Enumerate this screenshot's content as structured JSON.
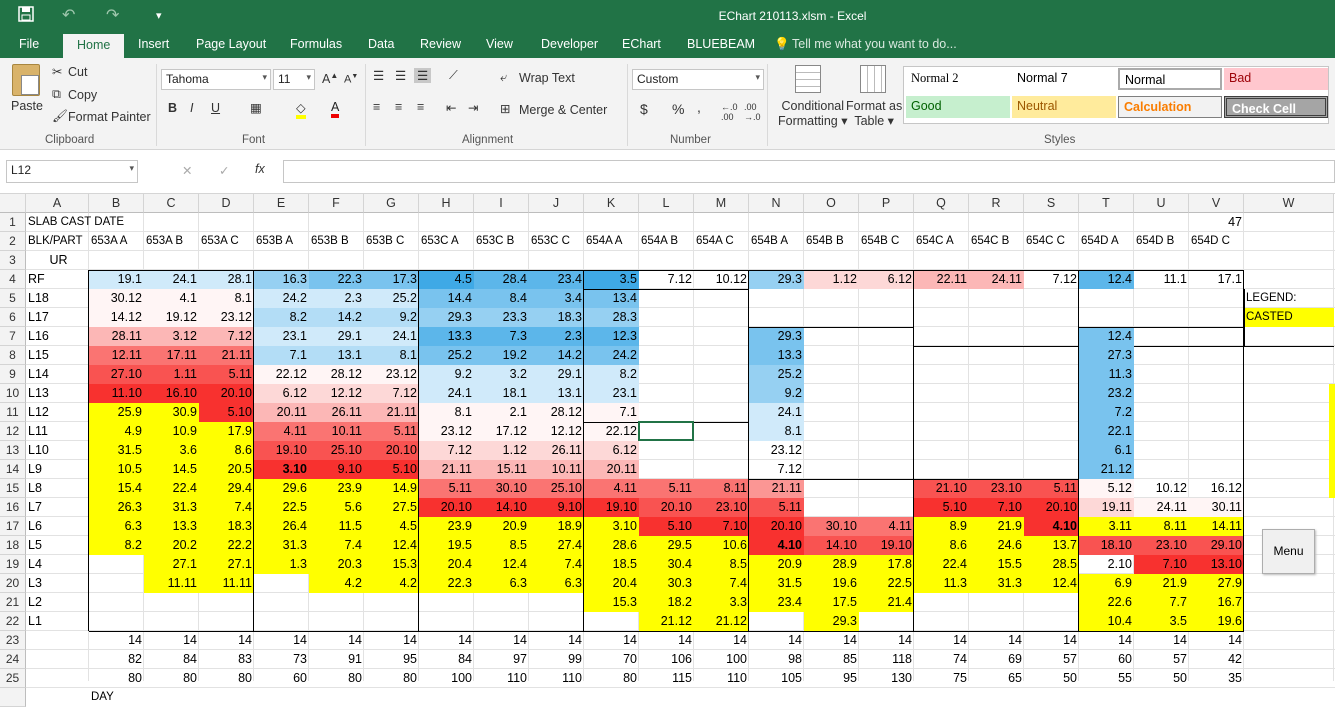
{
  "window": {
    "title": "EChart 210113.xlsm - Excel"
  },
  "quick_access": {
    "save_icon": "save-icon",
    "undo_icon": "undo-icon",
    "redo_icon": "redo-icon",
    "customize_icon": "customize-icon"
  },
  "menu_tabs": [
    "File",
    "Home",
    "Insert",
    "Page Layout",
    "Formulas",
    "Data",
    "Review",
    "View",
    "Developer",
    "EChart",
    "BLUEBEAM"
  ],
  "tell_me": "Tell me what you want to do...",
  "ribbon": {
    "clipboard": {
      "paste": "Paste",
      "cut": "Cut",
      "copy": "Copy",
      "format_painter": "Format Painter",
      "label": "Clipboard"
    },
    "font": {
      "name": "Tahoma",
      "size": "11",
      "label": "Font",
      "bold": "B",
      "italic": "I",
      "underline": "U"
    },
    "alignment": {
      "wrap": "Wrap Text",
      "merge": "Merge & Center",
      "label": "Alignment"
    },
    "number": {
      "format": "Custom",
      "currency": "$",
      "percent": "%",
      "comma": ",",
      "label": "Number"
    },
    "styles": {
      "cond_fmt_1": "Conditional",
      "cond_fmt_2": "Formatting",
      "format_table_1": "Format as",
      "format_table_2": "Table",
      "label": "Styles",
      "cells": [
        "Normal 2",
        "Normal 7",
        "Normal",
        "Bad",
        "Good",
        "Neutral",
        "Calculation",
        "Check Cell"
      ]
    }
  },
  "formula_bar": {
    "name_box": "L12",
    "cancel": "✕",
    "enter": "✓",
    "fx": "fx",
    "value": ""
  },
  "columns": [
    "A",
    "B",
    "C",
    "D",
    "E",
    "F",
    "G",
    "H",
    "I",
    "J",
    "K",
    "L",
    "M",
    "N",
    "O",
    "P",
    "Q",
    "R",
    "S",
    "T",
    "U",
    "V",
    "W"
  ],
  "rows": [
    "1",
    "2",
    "3",
    "4",
    "5",
    "6",
    "7",
    "8",
    "9",
    "10",
    "11",
    "12",
    "13",
    "14",
    "15",
    "16",
    "17",
    "18",
    "19",
    "20",
    "21",
    "22",
    "23",
    "24",
    "25"
  ],
  "sheet": {
    "r1": {
      "a": "SLAB CAST DATE",
      "v": "47"
    },
    "r2": [
      "BLK/PART",
      "653A A",
      "653A B",
      "653A C",
      "653B A",
      "653B B",
      "653B C",
      "653C A",
      "653C B",
      "653C C",
      "654A A",
      "654A B",
      "654A C",
      "654B A",
      "654B B",
      "654B C",
      "654C A",
      "654C B",
      "654C C",
      "654D A",
      "654D B",
      "654D C"
    ],
    "r3": "UR",
    "labels": [
      "RF",
      "L18",
      "L17",
      "L16",
      "L15",
      "L14",
      "L13",
      "L12",
      "L11",
      "L10",
      "L9",
      "L8",
      "L7",
      "L6",
      "L5",
      "L4",
      "L3",
      "L2",
      "L1"
    ],
    "data": [
      [
        "19.1",
        "24.1",
        "28.1",
        "16.3",
        "22.3",
        "17.3",
        "4.5",
        "28.4",
        "23.4",
        "3.5",
        "7.12",
        "10.12",
        "29.3",
        "1.12",
        "6.12",
        "22.11",
        "24.11",
        "7.12",
        "12.4",
        "11.1",
        "17.1"
      ],
      [
        "30.12",
        "4.1",
        "8.1",
        "24.2",
        "2.3",
        "25.2",
        "14.4",
        "8.4",
        "3.4",
        "13.4",
        "",
        "",
        "",
        "",
        "",
        "",
        "",
        "",
        "",
        "",
        ""
      ],
      [
        "14.12",
        "19.12",
        "23.12",
        "8.2",
        "14.2",
        "9.2",
        "29.3",
        "23.3",
        "18.3",
        "28.3",
        "",
        "",
        "",
        "",
        "",
        "",
        "",
        "",
        "",
        "",
        ""
      ],
      [
        "28.11",
        "3.12",
        "7.12",
        "23.1",
        "29.1",
        "24.1",
        "13.3",
        "7.3",
        "2.3",
        "12.3",
        "",
        "",
        "29.3",
        "",
        "",
        "",
        "",
        "",
        "12.4",
        "",
        ""
      ],
      [
        "12.11",
        "17.11",
        "21.11",
        "7.1",
        "13.1",
        "8.1",
        "25.2",
        "19.2",
        "14.2",
        "24.2",
        "",
        "",
        "13.3",
        "",
        "",
        "",
        "",
        "",
        "27.3",
        "",
        ""
      ],
      [
        "27.10",
        "1.11",
        "5.11",
        "22.12",
        "28.12",
        "23.12",
        "9.2",
        "3.2",
        "29.1",
        "8.2",
        "",
        "",
        "25.2",
        "",
        "",
        "",
        "",
        "",
        "11.3",
        "",
        ""
      ],
      [
        "11.10",
        "16.10",
        "20.10",
        "6.12",
        "12.12",
        "7.12",
        "24.1",
        "18.1",
        "13.1",
        "23.1",
        "",
        "",
        "9.2",
        "",
        "",
        "",
        "",
        "",
        "23.2",
        "",
        ""
      ],
      [
        "25.9",
        "30.9",
        "5.10",
        "20.11",
        "26.11",
        "21.11",
        "8.1",
        "2.1",
        "28.12",
        "7.1",
        "",
        "",
        "24.1",
        "",
        "",
        "",
        "",
        "",
        "7.2",
        "",
        ""
      ],
      [
        "4.9",
        "10.9",
        "17.9",
        "4.11",
        "10.11",
        "5.11",
        "23.12",
        "17.12",
        "12.12",
        "22.12",
        "",
        "",
        "8.1",
        "",
        "",
        "",
        "",
        "",
        "22.1",
        "",
        ""
      ],
      [
        "31.5",
        "3.6",
        "8.6",
        "19.10",
        "25.10",
        "20.10",
        "7.12",
        "1.12",
        "26.11",
        "6.12",
        "",
        "",
        "23.12",
        "",
        "",
        "",
        "",
        "",
        "6.1",
        "",
        ""
      ],
      [
        "10.5",
        "14.5",
        "20.5",
        "3.10",
        "9.10",
        "5.10",
        "21.11",
        "15.11",
        "10.11",
        "20.11",
        "",
        "",
        "7.12",
        "",
        "",
        "",
        "",
        "",
        "21.12",
        "",
        ""
      ],
      [
        "15.4",
        "22.4",
        "29.4",
        "29.6",
        "23.9",
        "14.9",
        "5.11",
        "30.10",
        "25.10",
        "4.11",
        "5.11",
        "8.11",
        "21.11",
        "",
        "",
        "21.10",
        "23.10",
        "5.11",
        "5.12",
        "10.12",
        "16.12"
      ],
      [
        "26.3",
        "31.3",
        "7.4",
        "22.5",
        "5.6",
        "27.5",
        "20.10",
        "14.10",
        "9.10",
        "19.10",
        "20.10",
        "23.10",
        "5.11",
        "",
        "",
        "5.10",
        "7.10",
        "20.10",
        "19.11",
        "24.11",
        "30.11"
      ],
      [
        "6.3",
        "13.3",
        "18.3",
        "26.4",
        "11.5",
        "4.5",
        "23.9",
        "20.9",
        "18.9",
        "3.10",
        "5.10",
        "7.10",
        "20.10",
        "30.10",
        "4.11",
        "8.9",
        "21.9",
        "4.10",
        "3.11",
        "8.11",
        "14.11"
      ],
      [
        "8.2",
        "20.2",
        "22.2",
        "31.3",
        "7.4",
        "12.4",
        "19.5",
        "8.5",
        "27.4",
        "28.6",
        "29.5",
        "10.6",
        "4.10",
        "14.10",
        "19.10",
        "8.6",
        "24.6",
        "13.7",
        "18.10",
        "23.10",
        "29.10"
      ],
      [
        "",
        "27.1",
        "27.1",
        "1.3",
        "20.3",
        "15.3",
        "20.4",
        "12.4",
        "7.4",
        "18.5",
        "30.4",
        "8.5",
        "20.9",
        "28.9",
        "17.8",
        "22.4",
        "15.5",
        "28.5",
        "2.10",
        "7.10",
        "13.10"
      ],
      [
        "",
        "11.11",
        "11.11",
        "",
        "4.2",
        "4.2",
        "22.3",
        "6.3",
        "6.3",
        "20.4",
        "30.3",
        "7.4",
        "31.5",
        "19.6",
        "22.5",
        "11.3",
        "31.3",
        "12.4",
        "6.9",
        "21.9",
        "27.9"
      ],
      [
        "",
        "",
        "",
        "",
        "",
        "",
        "",
        "",
        "",
        "15.3",
        "18.2",
        "3.3",
        "23.4",
        "17.5",
        "21.4",
        "",
        "",
        "",
        "22.6",
        "7.7",
        "16.7"
      ],
      [
        "",
        "",
        "",
        "",
        "",
        "",
        "",
        "",
        "",
        "",
        "21.12",
        "21.12",
        "",
        "29.3",
        "",
        "",
        "",
        "",
        "10.4",
        "3.5",
        "19.6"
      ]
    ],
    "r23": [
      "14",
      "14",
      "14",
      "14",
      "14",
      "14",
      "14",
      "14",
      "14",
      "14",
      "14",
      "14",
      "14",
      "14",
      "14",
      "14",
      "14",
      "14",
      "14",
      "14",
      "14"
    ],
    "r24": [
      "82",
      "84",
      "83",
      "73",
      "91",
      "95",
      "84",
      "97",
      "99",
      "70",
      "106",
      "100",
      "98",
      "85",
      "118",
      "74",
      "69",
      "57",
      "60",
      "57",
      "42"
    ],
    "r25": [
      "80",
      "80",
      "80",
      "60",
      "80",
      "80",
      "100",
      "110",
      "110",
      "80",
      "115",
      "110",
      "105",
      "95",
      "130",
      "75",
      "65",
      "50",
      "55",
      "50",
      "35"
    ],
    "r26": "DAY",
    "legend": "LEGEND:",
    "casted": "CASTED"
  },
  "menu_button": "Menu",
  "colors": {
    "excel_green": "#217346",
    "yellow": "#FFFF00",
    "red_strong": "#F8312F",
    "blue_strong": "#3FA9E6"
  }
}
